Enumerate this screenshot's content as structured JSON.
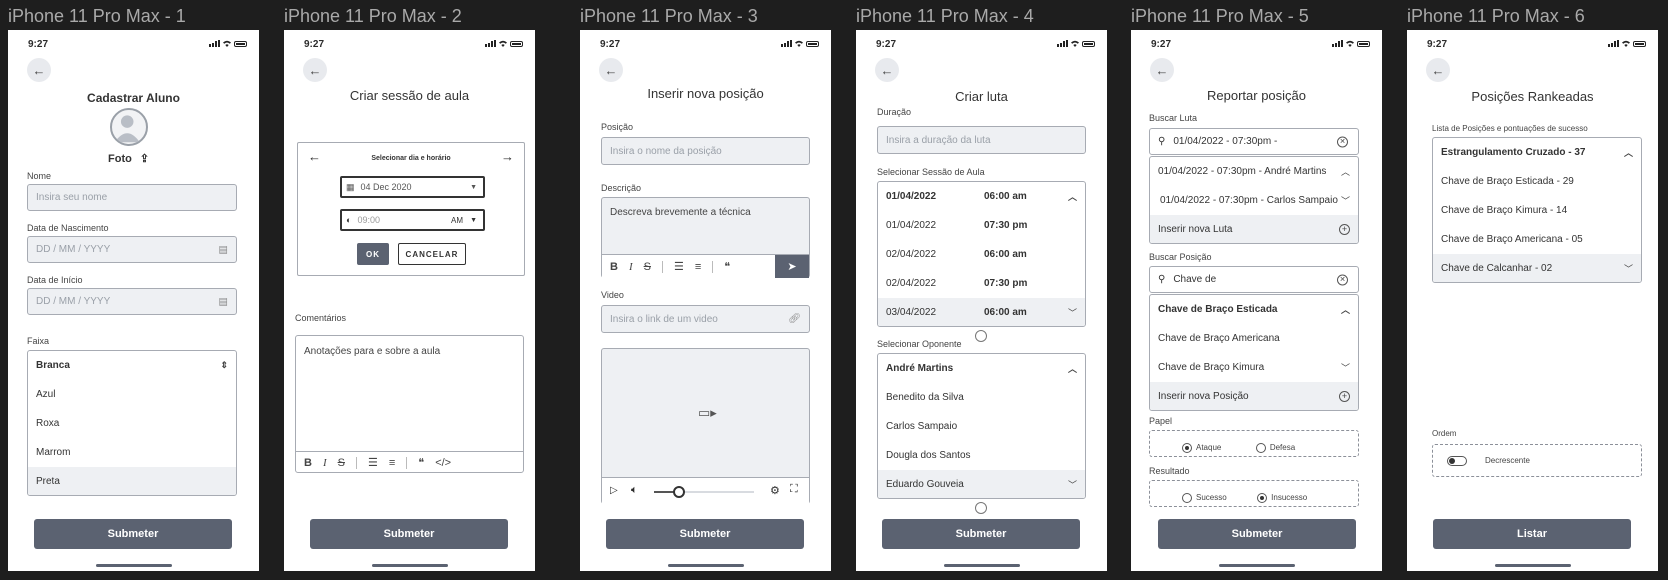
{
  "frames": [
    {
      "title": "iPhone 11 Pro Max - 1"
    },
    {
      "title": "iPhone 11 Pro Max - 2"
    },
    {
      "title": "iPhone 11 Pro Max - 3"
    },
    {
      "title": "iPhone 11 Pro Max - 4"
    },
    {
      "title": "iPhone 11 Pro Max - 5"
    },
    {
      "title": "iPhone 11 Pro Max - 6"
    }
  ],
  "status": {
    "time": "9:27"
  },
  "screen1": {
    "title": "Cadastrar Aluno",
    "photo_label": "Foto",
    "name_label": "Nome",
    "name_placeholder": "Insira seu nome",
    "birth_label": "Data de Nascimento",
    "birth_placeholder": "DD / MM / YYYY",
    "start_label": "Data de Início",
    "start_placeholder": "DD / MM / YYYY",
    "belt_label": "Faixa",
    "belts": [
      "Branca",
      "Azul",
      "Roxa",
      "Marrom",
      "Preta"
    ],
    "submit": "Submeter"
  },
  "screen2": {
    "title": "Criar sessão de aula",
    "picker_title": "Selecionar dia e horário",
    "date_value": "04 Dec 2020",
    "time_value": "09:00",
    "ampm": "AM",
    "ok": "OK",
    "cancel": "CANCELAR",
    "comments_label": "Comentários",
    "comments_value": "Anotações para e sobre a aula",
    "submit": "Submeter"
  },
  "screen3": {
    "title": "Inserir nova posição",
    "position_label": "Posição",
    "position_placeholder": "Insira o nome da posição",
    "description_label": "Descrição",
    "description_placeholder": "Descreva brevemente a técnica",
    "video_label": "Video",
    "video_placeholder": "Insira o link de um video",
    "video_progress": 0.25,
    "submit": "Submeter"
  },
  "screen4": {
    "title": "Criar luta",
    "duration_label": "Duração",
    "duration_placeholder": "Insira a duração da luta",
    "session_label": "Selecionar Sessão de Aula",
    "sessions": [
      {
        "date": "01/04/2022",
        "time": "06:00 am"
      },
      {
        "date": "01/04/2022",
        "time": "07:30 pm"
      },
      {
        "date": "02/04/2022",
        "time": "06:00 am"
      },
      {
        "date": "02/04/2022",
        "time": "07:30 pm"
      },
      {
        "date": "03/04/2022",
        "time": "06:00 am"
      }
    ],
    "opponent_label": "Selecionar Oponente",
    "opponents": [
      "André Martins",
      "Benedito da Silva",
      "Carlos Sampaio",
      "Dougla dos Santos",
      "Eduardo Gouveia"
    ],
    "submit": "Submeter"
  },
  "screen5": {
    "title": "Reportar posição",
    "fight_search_label": "Buscar Luta",
    "fight_search_value": "01/04/2022 - 07:30pm -",
    "fight_results": [
      "01/04/2022 - 07:30pm - André Martins",
      "01/04/2022 - 07:30pm - Carlos Sampaio"
    ],
    "new_fight": "Inserir nova Luta",
    "position_search_label": "Buscar Posição",
    "position_search_value": "Chave de",
    "position_results": [
      "Chave de Braço Esticada",
      "Chave de Braço Americana",
      "Chave de Braço Kimura"
    ],
    "new_position": "Inserir nova Posição",
    "role_label": "Papel",
    "role_attack": "Ataque",
    "role_defense": "Defesa",
    "result_label": "Resultado",
    "result_success": "Sucesso",
    "result_fail": "Insucesso",
    "submit": "Submeter"
  },
  "screen6": {
    "title": "Posições Rankeadas",
    "list_label": "Lista de Posições e  pontuações de sucesso",
    "items": [
      "Estrangulamento Cruzado - 37",
      "Chave de Braço Esticada  - 29",
      "Chave de Braço Kimura - 14",
      "Chave de Braço Americana - 05",
      "Chave de Calcanhar - 02"
    ],
    "order_label": "Ordem",
    "order_value": "Decrescente",
    "submit": "Listar"
  }
}
